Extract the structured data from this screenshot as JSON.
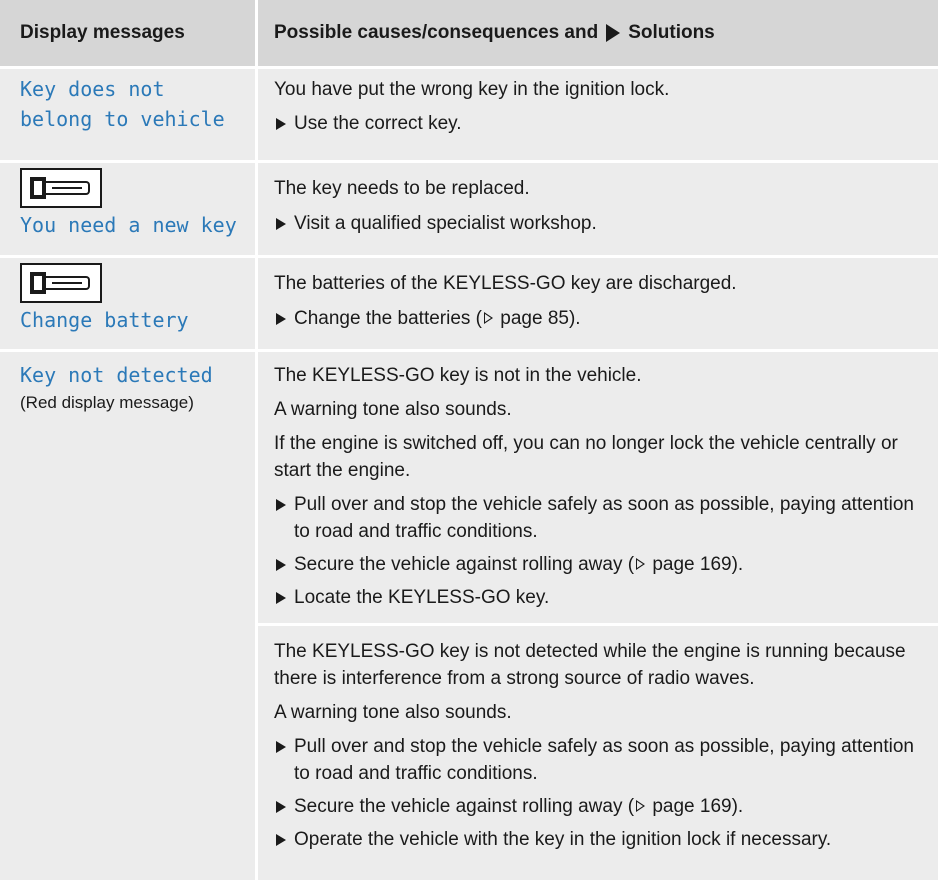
{
  "header": {
    "col1": "Display messages",
    "col2_prefix": "Possible causes/consequences and",
    "col2_suffix": "Solutions"
  },
  "rows": [
    {
      "message_line1": "Key does not",
      "message_line2": "belong to vehicle",
      "cause": "You have put the wrong key in the ignition lock.",
      "bullets": [
        "Use the correct key."
      ]
    },
    {
      "icon": "key-icon",
      "message": "You need a new key",
      "cause": "The key needs to be replaced.",
      "bullets": [
        "Visit a qualified specialist workshop."
      ]
    },
    {
      "icon": "key-icon",
      "message": "Change battery",
      "cause": "The batteries of the KEYLESS-GO key are discharged.",
      "bullet_prefix": "Change the batteries (",
      "bullet_ref": "page 85).",
      "bullets": []
    },
    {
      "message": "Key not detected",
      "sub_message": "(Red display message)",
      "blocks": [
        {
          "paras": [
            "The KEYLESS-GO key is not in the vehicle.",
            "A warning tone also sounds.",
            "If the engine is switched off, you can no longer lock the vehicle centrally or start the engine."
          ],
          "bullet1": "Pull over and stop the vehicle safely as soon as possible, paying attention to road and traffic conditions.",
          "bullet2_prefix": "Secure the vehicle against rolling away (",
          "bullet2_ref": "page 169).",
          "bullet3": "Locate the KEYLESS-GO key."
        },
        {
          "paras": [
            "The KEYLESS-GO key is not detected while the engine is running because there is interference from a strong source of radio waves.",
            "A warning tone also sounds."
          ],
          "bullet1": "Pull over and stop the vehicle safely as soon as possible, paying attention to road and traffic conditions.",
          "bullet2_prefix": "Secure the vehicle against rolling away (",
          "bullet2_ref": "page 169).",
          "bullet3": "Operate the vehicle with the key in the ignition lock if necessary."
        }
      ]
    }
  ]
}
